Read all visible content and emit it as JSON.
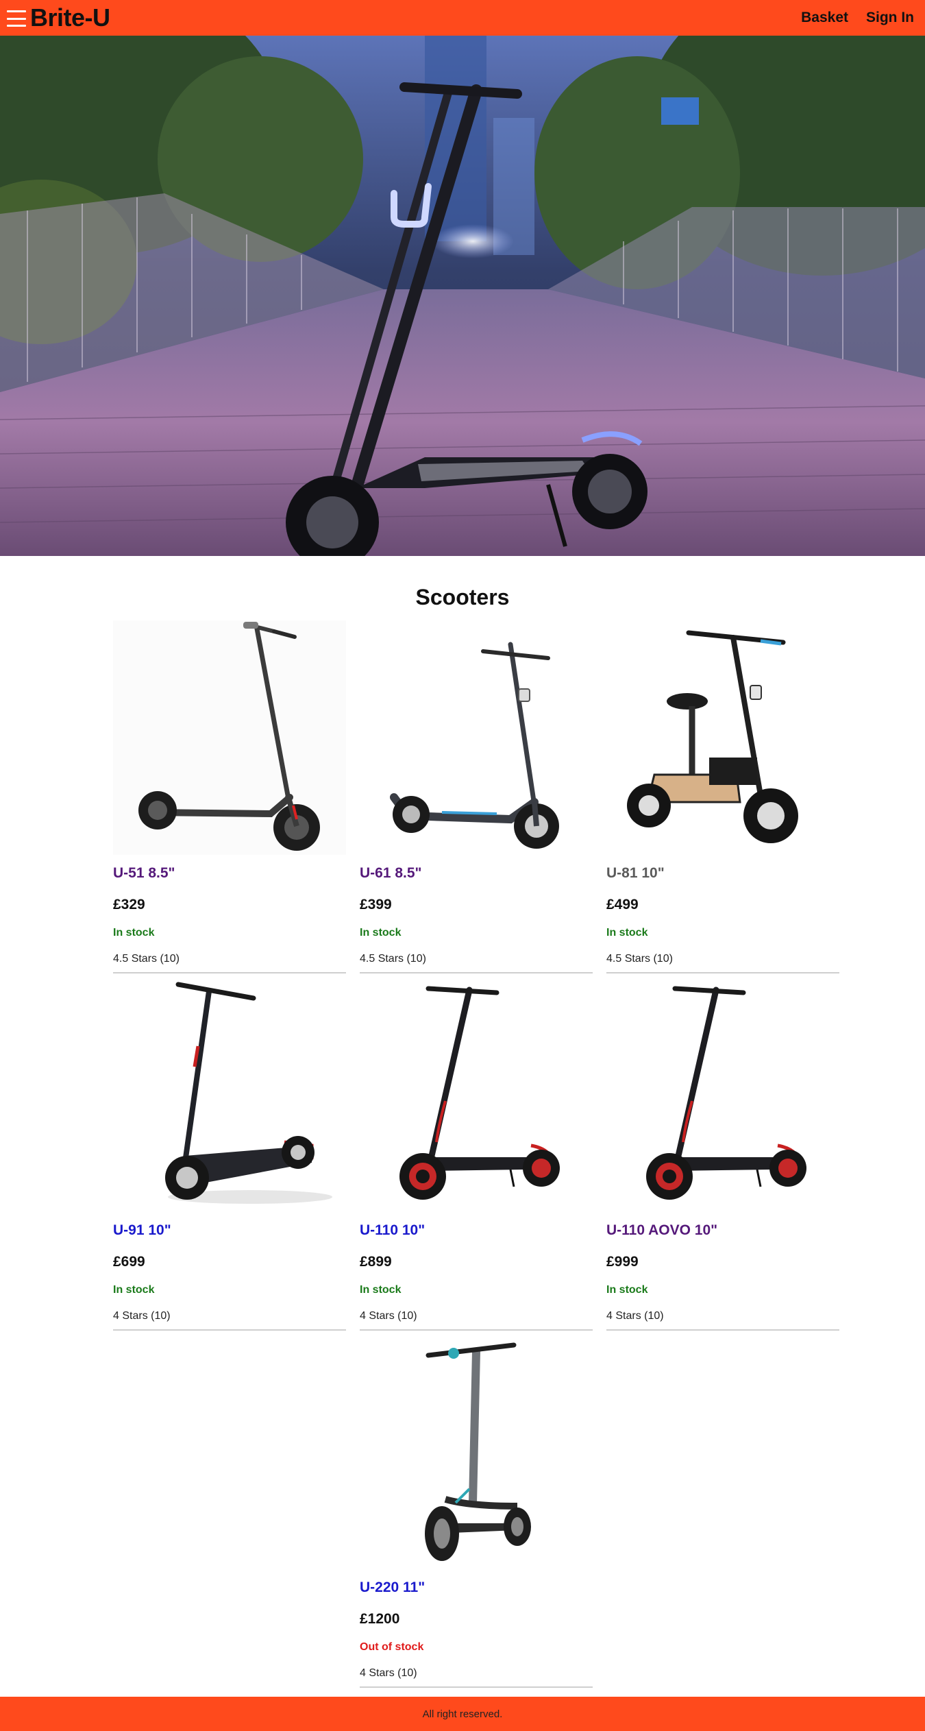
{
  "header": {
    "brand": "Brite-U",
    "nav": {
      "basket": "Basket",
      "sign_in": "Sign In"
    }
  },
  "colors": {
    "brand_orange": "#ff4a1c",
    "in_stock": "#1a7a1a",
    "out_of_stock": "#e01b1b",
    "link_visited": "#55197a",
    "link_unvisited": "#1a1acc",
    "link_hover": "#5a5a5a"
  },
  "main": {
    "title": "Scooters",
    "products": [
      {
        "name": "U-51 8.5\"",
        "price": "£329",
        "stock": "In stock",
        "rating": "4.5 Stars (10)",
        "link_color": "#55197a",
        "stock_color": "#1a7a1a",
        "icon": "scooter-folding-icon"
      },
      {
        "name": "U-61 8.5\"",
        "price": "£399",
        "stock": "In stock",
        "rating": "4.5 Stars (10)",
        "link_color": "#55197a",
        "stock_color": "#1a7a1a",
        "icon": "scooter-light-icon"
      },
      {
        "name": "U-81 10\"",
        "price": "£499",
        "stock": "In stock",
        "rating": "4.5 Stars (10)",
        "link_color": "#5a5a5a",
        "stock_color": "#1a7a1a",
        "icon": "scooter-seated-icon"
      },
      {
        "name": "U-91 10\"",
        "price": "£699",
        "stock": "In stock",
        "rating": "4 Stars (10)",
        "link_color": "#1a1acc",
        "stock_color": "#1a7a1a",
        "icon": "scooter-deck-icon"
      },
      {
        "name": "U-110 10\"",
        "price": "£899",
        "stock": "In stock",
        "rating": "4 Stars (10)",
        "link_color": "#1a1acc",
        "stock_color": "#1a7a1a",
        "icon": "scooter-red-icon"
      },
      {
        "name": "U-110 AOVO 10\"",
        "price": "£999",
        "stock": "In stock",
        "rating": "4 Stars (10)",
        "link_color": "#55197a",
        "stock_color": "#1a7a1a",
        "icon": "scooter-red-icon"
      },
      {
        "name": "U-220 11\"",
        "price": "£1200",
        "stock": "Out of stock",
        "rating": "4 Stars (10)",
        "link_color": "#1a1acc",
        "stock_color": "#e01b1b",
        "icon": "scooter-teal-icon"
      }
    ]
  },
  "footer": {
    "text": "All right reserved."
  }
}
